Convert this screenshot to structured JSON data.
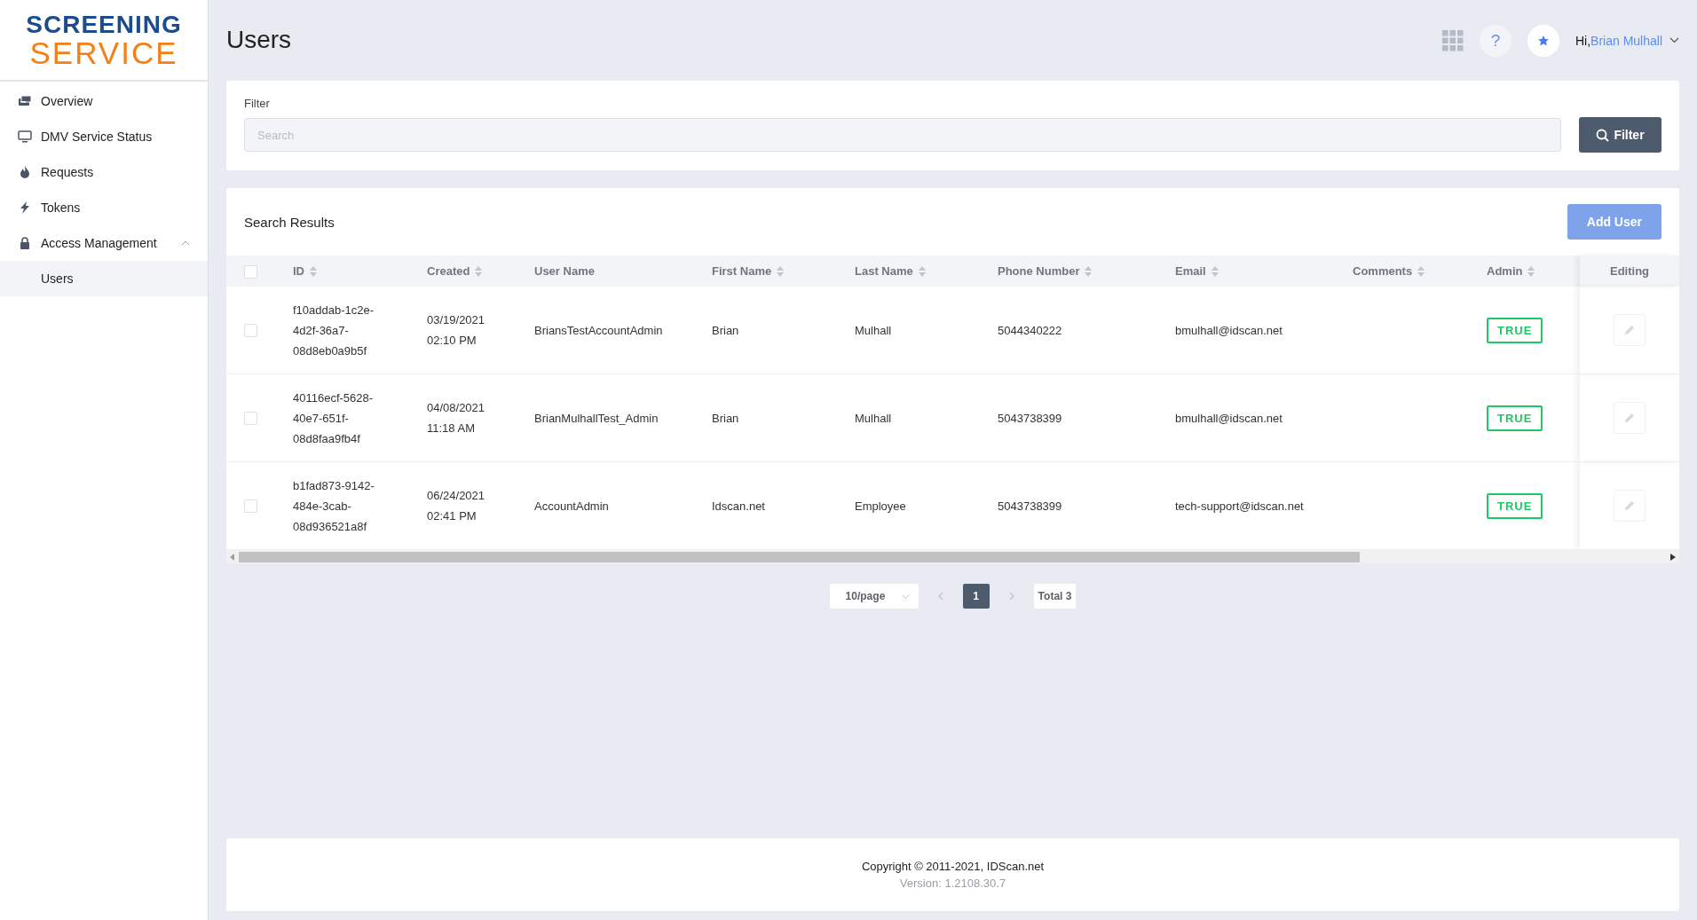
{
  "logo": {
    "line1": "SCREENING",
    "line2": "SERVICE"
  },
  "sidebar": {
    "items": [
      {
        "label": "Overview",
        "selected": false
      },
      {
        "label": "DMV Service Status",
        "selected": false
      },
      {
        "label": "Requests",
        "selected": false
      },
      {
        "label": "Tokens",
        "selected": false
      },
      {
        "label": "Access Management",
        "expanded": true,
        "selected": false,
        "children": [
          {
            "label": "Users",
            "selected": true
          }
        ]
      }
    ]
  },
  "header": {
    "title": "Users",
    "help": "?",
    "greeting": "Hi,",
    "user_name": "Brian Mulhall"
  },
  "filter": {
    "label": "Filter",
    "placeholder": "Search",
    "button": "Filter"
  },
  "results": {
    "title": "Search Results",
    "add_button": "Add User",
    "add_disabled": true,
    "columns": [
      {
        "label": "ID",
        "sortable": true
      },
      {
        "label": "Created",
        "sortable": true
      },
      {
        "label": "User Name",
        "sortable": false
      },
      {
        "label": "First Name",
        "sortable": true
      },
      {
        "label": "Last Name",
        "sortable": true
      },
      {
        "label": "Phone Number",
        "sortable": true
      },
      {
        "label": "Email",
        "sortable": true
      },
      {
        "label": "Comments",
        "sortable": true
      },
      {
        "label": "Admin",
        "sortable": true
      },
      {
        "label": "Editing",
        "sortable": false
      }
    ],
    "all_checked": false,
    "rows": [
      {
        "checked": false,
        "id": [
          "f10addab-1c2e-",
          "4d2f-36a7-",
          "08d8eb0a9b5f"
        ],
        "created": [
          "03/19/2021",
          "02:10 PM"
        ],
        "user_name": "BriansTestAccountAdmin",
        "first_name": "Brian",
        "last_name": "Mulhall",
        "phone": "5044340222",
        "email": "bmulhall@idscan.net",
        "admin": "TRUE"
      },
      {
        "checked": false,
        "id": [
          "40116ecf-5628-",
          "40e7-651f-",
          "08d8faa9fb4f"
        ],
        "created": [
          "04/08/2021",
          "11:18 AM"
        ],
        "user_name": "BrianMulhallTest_Admin",
        "first_name": "Brian",
        "last_name": "Mulhall",
        "phone": "5043738399",
        "email": "bmulhall@idscan.net",
        "admin": "TRUE"
      },
      {
        "checked": false,
        "id": [
          "b1fad873-9142-",
          "484e-3cab-",
          "08d936521a8f"
        ],
        "created": [
          "06/24/2021",
          "02:41 PM"
        ],
        "user_name": "AccountAdmin",
        "first_name": "Idscan.net",
        "last_name": "Employee",
        "phone": "5043738399",
        "email": "tech-support@idscan.net",
        "admin": "TRUE"
      }
    ]
  },
  "pagination": {
    "page_size": "10/page",
    "pages": [
      {
        "label": "1",
        "selected": true
      }
    ],
    "total": "Total 3"
  },
  "footer": {
    "copyright": "Copyright © 2011-2021, IDScan.net",
    "version": "Version: 1.2108.30.7"
  }
}
